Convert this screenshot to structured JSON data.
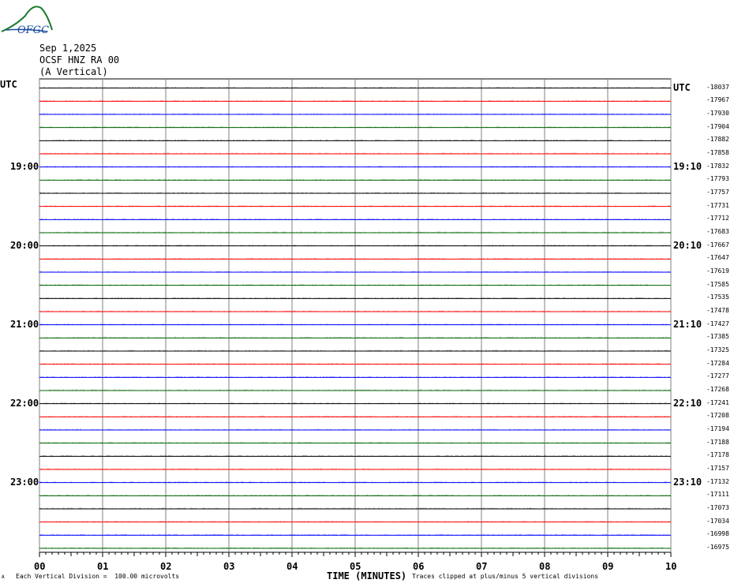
{
  "header": {
    "logo_text": "OFGC",
    "date": "Sep 1,2025",
    "station": "OCSF HNZ RA 00",
    "component": "(A Vertical)",
    "utc_left": "UTC",
    "utc_right": "UTC"
  },
  "footer": {
    "scale_note": "Each Vertical Division =  100.00 microvolts",
    "clip_note": "Traces clipped at plus/minus 5 vertical divisions",
    "corner_mark": "A"
  },
  "chart_data": {
    "type": "line",
    "title": "",
    "xlabel": "TIME (MINUTES)",
    "xlim": [
      0,
      10
    ],
    "x_ticks": [
      "00",
      "01",
      "02",
      "03",
      "04",
      "05",
      "06",
      "07",
      "08",
      "09",
      "10"
    ],
    "row_duration_minutes": 10,
    "trace_colors": [
      "#000000",
      "#ff0000",
      "#0000ff",
      "#006400"
    ],
    "left_hour_labels": [
      {
        "row": 6,
        "label": "19:00"
      },
      {
        "row": 12,
        "label": "20:00"
      },
      {
        "row": 18,
        "label": "21:00"
      },
      {
        "row": 24,
        "label": "22:00"
      },
      {
        "row": 30,
        "label": "23:00"
      }
    ],
    "right_hour_labels": [
      {
        "row": 0,
        "label": "UTC"
      },
      {
        "row": 6,
        "label": "19:10"
      },
      {
        "row": 12,
        "label": "20:10"
      },
      {
        "row": 18,
        "label": "21:10"
      },
      {
        "row": 24,
        "label": "22:10"
      },
      {
        "row": 30,
        "label": "23:10"
      }
    ],
    "row_values": [
      "-18037",
      "-17967",
      "-17930",
      "-17904",
      "-17882",
      "-17858",
      "-17832",
      "-17793",
      "-17757",
      "-17731",
      "-17712",
      "-17683",
      "-17667",
      "-17647",
      "-17619",
      "-17585",
      "-17535",
      "-17478",
      "-17427",
      "-17385",
      "-17325",
      "-17284",
      "-17277",
      "-17268",
      "-17241",
      "-17208",
      "-17194",
      "-17188",
      "-17178",
      "-17157",
      "-17132",
      "-17111",
      "-17073",
      "-17034",
      "-16998",
      "-16975"
    ],
    "grid": true
  }
}
